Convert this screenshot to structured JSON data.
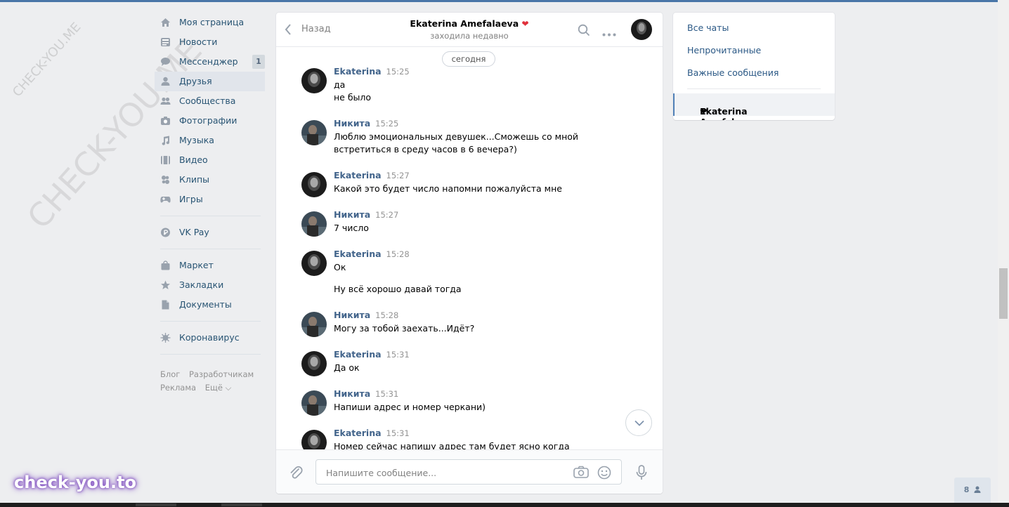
{
  "nav": {
    "items": [
      {
        "label": "Моя страница",
        "icon": "home-icon"
      },
      {
        "label": "Новости",
        "icon": "news-icon"
      },
      {
        "label": "Мессенджер",
        "icon": "messenger-icon",
        "badge": "1"
      },
      {
        "label": "Друзья",
        "icon": "friends-icon",
        "active": true
      },
      {
        "label": "Сообщества",
        "icon": "communities-icon"
      },
      {
        "label": "Фотографии",
        "icon": "camera-icon"
      },
      {
        "label": "Музыка",
        "icon": "music-icon"
      },
      {
        "label": "Видео",
        "icon": "video-icon"
      },
      {
        "label": "Клипы",
        "icon": "clips-icon"
      },
      {
        "label": "Игры",
        "icon": "gamepad-icon"
      }
    ],
    "pay": {
      "label": "VK Pay",
      "icon": "vkpay-icon"
    },
    "extra": [
      {
        "label": "Маркет",
        "icon": "market-icon"
      },
      {
        "label": "Закладки",
        "icon": "star-icon"
      },
      {
        "label": "Документы",
        "icon": "document-icon"
      }
    ],
    "corona": {
      "label": "Коронавирус",
      "icon": "virus-icon"
    },
    "footer": {
      "blog": "Блог",
      "developers": "Разработчикам",
      "ads": "Реклама",
      "more": "Ещё ⌵"
    }
  },
  "chat": {
    "back_label": "Назад",
    "peer_name": "Ekaterina Amefalaeva",
    "peer_heart": "❤",
    "peer_status": "заходила недавно",
    "date_label": "сегодня",
    "messages": [
      {
        "author": "Ekaterina",
        "time": "15:25",
        "lines": [
          "да",
          "не было"
        ]
      },
      {
        "author": "Никита",
        "time": "15:25",
        "lines": [
          "Люблю эмоциональных девушек...Сможешь со мной встретиться в среду часов в 6 вечера?)"
        ]
      },
      {
        "author": "Ekaterina",
        "time": "15:27",
        "lines": [
          "Какой это будет число напомни пожалуйста мне"
        ]
      },
      {
        "author": "Никита",
        "time": "15:27",
        "lines": [
          "7 число"
        ]
      },
      {
        "author": "Ekaterina",
        "time": "15:28",
        "lines": [
          "Ок",
          "Ну всё хорошо давай тогда"
        ]
      },
      {
        "author": "Никита",
        "time": "15:28",
        "lines": [
          "Могу за тобой заехать...Идёт?"
        ]
      },
      {
        "author": "Ekaterina",
        "time": "15:31",
        "lines": [
          "Да ок"
        ]
      },
      {
        "author": "Никита",
        "time": "15:31",
        "lines": [
          "Напиши адрес и номер черкани)"
        ]
      },
      {
        "author": "Ekaterina",
        "time": "15:31",
        "lines": [
          "Номер сейчас напишу адрес там будет ясно когда что кого"
        ]
      }
    ],
    "composer": {
      "placeholder": "Напишите сообщение..."
    }
  },
  "right_panel": {
    "all_chats": "Все чаты",
    "unread": "Непрочитанные",
    "important": "Важные сообщения",
    "active_chat": "Ekaterina Amefalaeva",
    "active_heart": "❤"
  },
  "online_count": "8",
  "watermarks": {
    "small": "CHECK-YOU.ME",
    "large": "CHECK-YOU.ME",
    "bottom": "check-you.to"
  },
  "colors": {
    "accent": "#4a76a8",
    "link": "#285473",
    "author": "#42648b",
    "background": "#edeef0"
  }
}
